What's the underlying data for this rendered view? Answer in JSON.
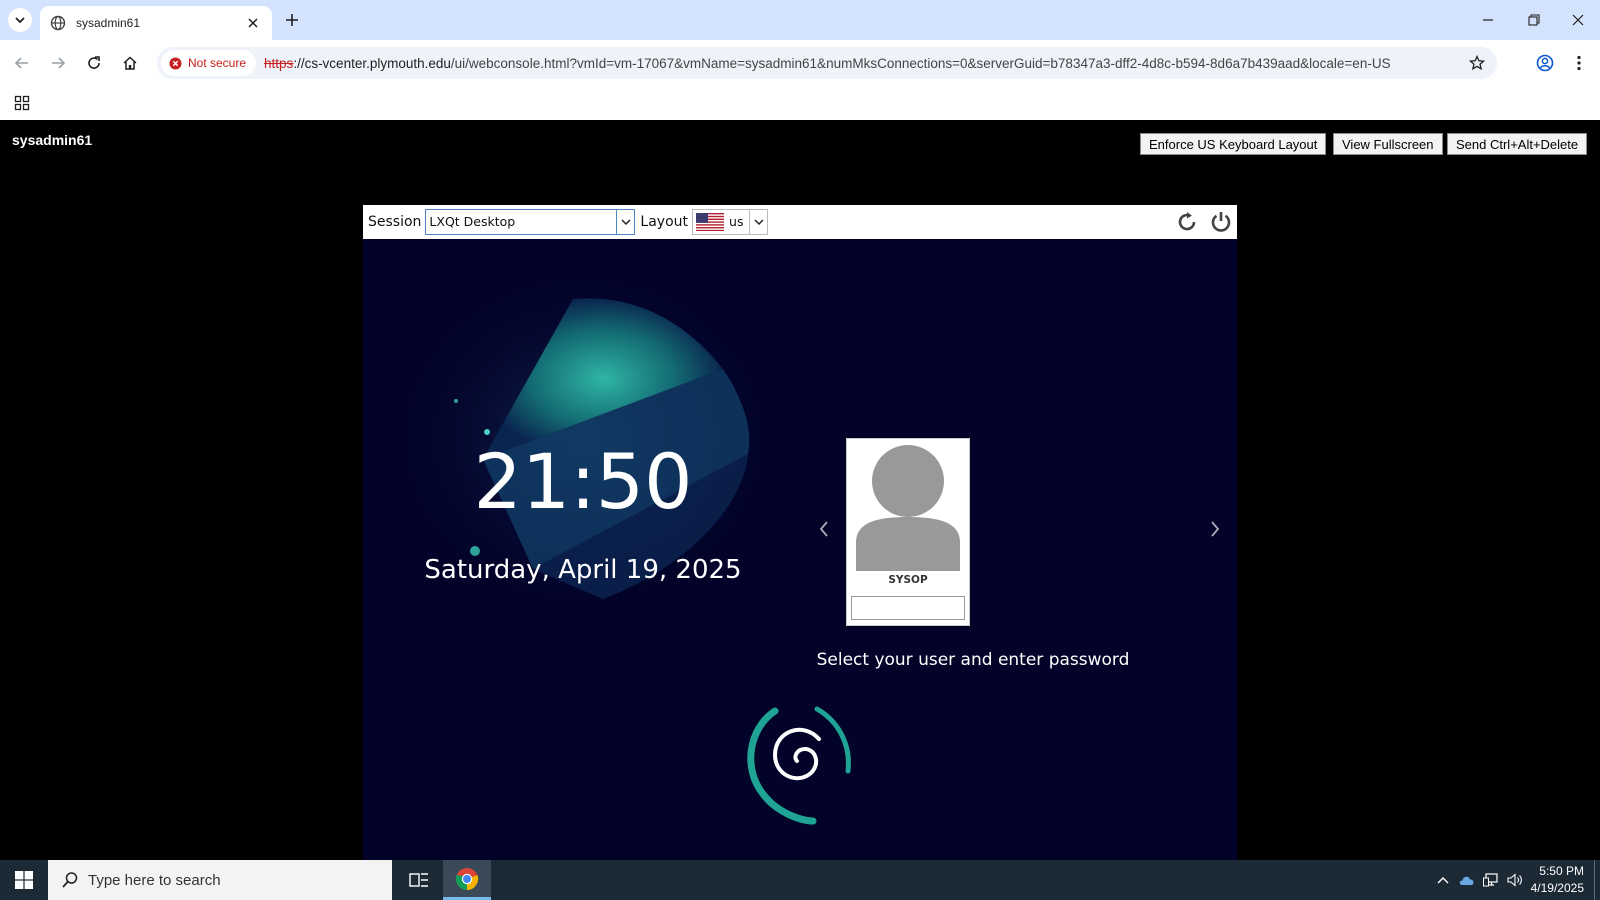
{
  "browser": {
    "tab": {
      "title": "sysadmin61"
    },
    "new_tab_label": "+",
    "security": {
      "label": "Not secure"
    },
    "url": {
      "scheme": "https",
      "host": "://cs-vcenter.plymouth.edu",
      "path": "/ui/webconsole.html?vmId=vm-17067&vmName=sysadmin61&numMksConnections=0&serverGuid=b78347a3-dff2-4d8c-b594-8d6a7b439aad&locale=en-US"
    }
  },
  "console": {
    "vm_name": "sysadmin61",
    "buttons": {
      "enforce_keyboard": "Enforce US Keyboard Layout",
      "fullscreen": "View Fullscreen",
      "ctrl_alt_del": "Send Ctrl+Alt+Delete"
    }
  },
  "greeter": {
    "session_label": "Session",
    "session_value": "LXQt Desktop",
    "layout_label": "Layout",
    "layout_value": "us",
    "time": "21:50",
    "date": "Saturday, April 19, 2025",
    "user": {
      "name": "SYSOP"
    },
    "password_value": "",
    "prompt": "Select your user and enter password",
    "colors": {
      "background": "#03032a",
      "accent": "#1fa394"
    }
  },
  "taskbar": {
    "search_placeholder": "Type here to search",
    "clock_time": "5:50 PM",
    "clock_date": "4/19/2025"
  }
}
